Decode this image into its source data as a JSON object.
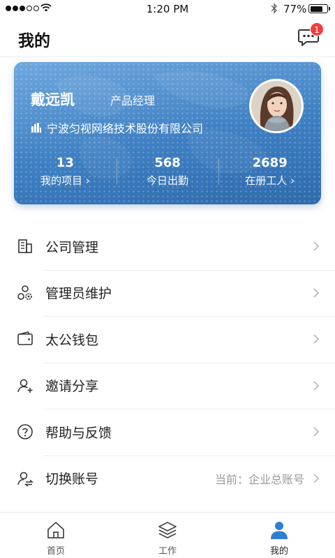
{
  "status_bar": {
    "time": "1:20 PM",
    "battery": "77%",
    "battery_level": 0.77
  },
  "header": {
    "title": "我的",
    "message_badge": "1"
  },
  "profile": {
    "name": "戴远凯",
    "role": "产品经理",
    "company": "宁波匀视网络技术股份有限公司",
    "stats": [
      {
        "value": "13",
        "label": "我的项目"
      },
      {
        "value": "568",
        "label": "今日出勤"
      },
      {
        "value": "2689",
        "label": "在册工人"
      }
    ]
  },
  "menu": [
    {
      "label": "公司管理",
      "icon": "building-icon"
    },
    {
      "label": "管理员维护",
      "icon": "admin-gear-icon"
    },
    {
      "label": "太公钱包",
      "icon": "wallet-icon"
    },
    {
      "label": "邀请分享",
      "icon": "invite-user-icon"
    },
    {
      "label": "帮助与反馈",
      "icon": "help-icon"
    },
    {
      "label": "切换账号",
      "icon": "switch-account-icon",
      "value": "当前：企业总账号"
    }
  ],
  "tabbar": [
    {
      "label": "首页",
      "icon": "home-icon"
    },
    {
      "label": "工作",
      "icon": "layers-icon"
    },
    {
      "label": "我的",
      "icon": "user-icon",
      "active": true
    }
  ],
  "colors": {
    "accent": "#2f7fd0",
    "card_top": "#6fa8de",
    "card_bottom": "#2e6aac",
    "badge": "#f23d3d"
  }
}
